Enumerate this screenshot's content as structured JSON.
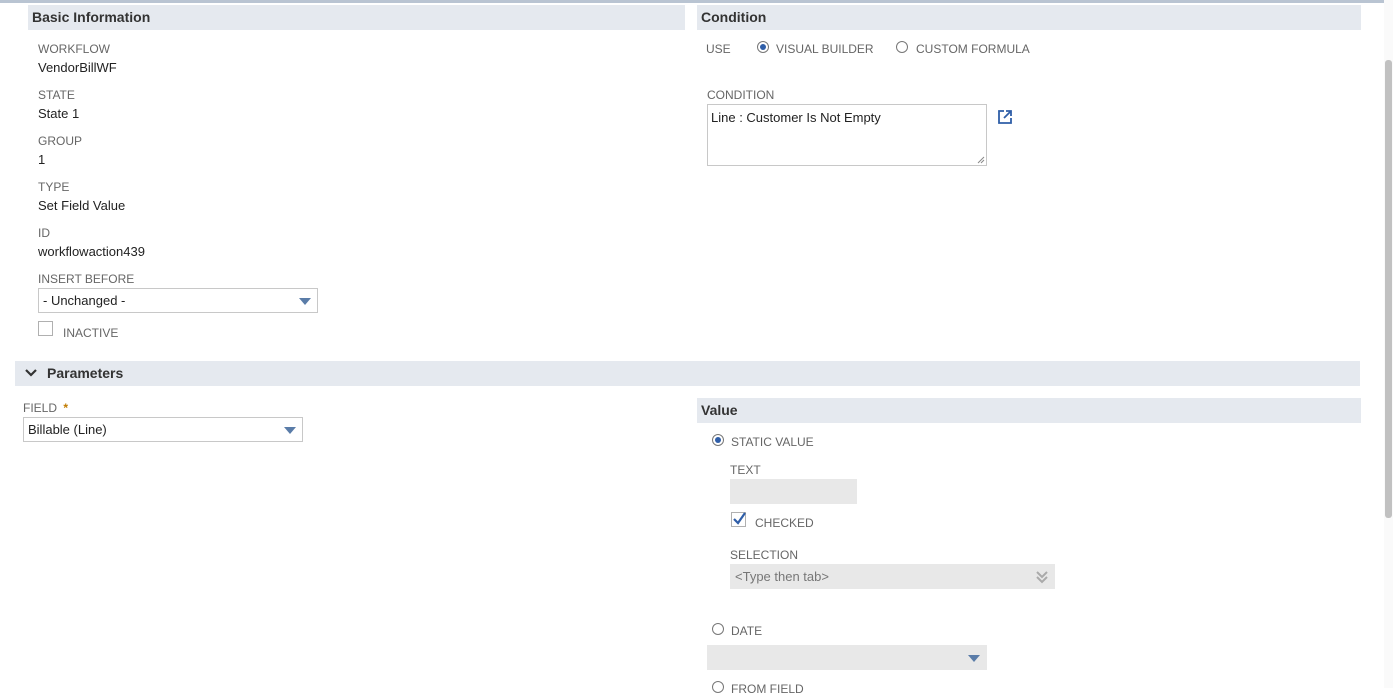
{
  "basic_info": {
    "header": "Basic Information",
    "workflow_label": "WORKFLOW",
    "workflow_value": "VendorBillWF",
    "state_label": "STATE",
    "state_value": "State 1",
    "group_label": "GROUP",
    "group_value": "1",
    "type_label": "TYPE",
    "type_value": "Set Field Value",
    "id_label": "ID",
    "id_value": "workflowaction439",
    "insert_before_label": "INSERT BEFORE",
    "insert_before_value": "- Unchanged -",
    "inactive_label": "INACTIVE"
  },
  "condition": {
    "header": "Condition",
    "use_label": "USE",
    "visual_builder_label": "VISUAL BUILDER",
    "custom_formula_label": "CUSTOM FORMULA",
    "selected_mode": "visual_builder",
    "condition_label": "CONDITION",
    "condition_value": "Line : Customer Is Not Empty"
  },
  "parameters": {
    "header": "Parameters",
    "field_label": "FIELD",
    "required_mark": "*",
    "field_value": "Billable (Line)"
  },
  "value": {
    "header": "Value",
    "static_value_label": "STATIC VALUE",
    "static_selected": true,
    "text_label": "TEXT",
    "checked_label": "CHECKED",
    "checked": true,
    "selection_label": "SELECTION",
    "selection_placeholder": "<Type then tab>",
    "date_label": "DATE",
    "from_field_label": "FROM FIELD"
  },
  "colors": {
    "accent": "#2f5ea8",
    "section_bg": "#e5e9ef",
    "required": "#c17b00"
  }
}
